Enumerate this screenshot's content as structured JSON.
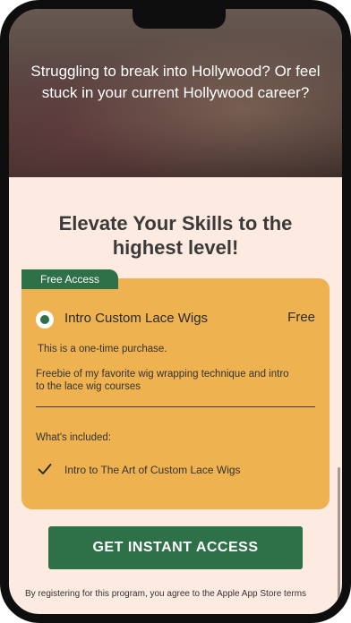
{
  "hero": {
    "text": "Struggling to break into Hollywood? Or feel stuck in your current Hollywood career?"
  },
  "headline": "Elevate Your Skills to the highest level!",
  "plan": {
    "badge": "Free Access",
    "name": "Intro Custom Lace Wigs",
    "price": "Free",
    "purchase_note": "This is a one-time purchase.",
    "description": "Freebie of my favorite wig wrapping technique and intro to the lace wig courses",
    "included_label": "What's included:",
    "included_items": [
      "Intro to The Art of Custom Lace Wigs"
    ],
    "selected": true
  },
  "cta": {
    "label": "GET INSTANT ACCESS"
  },
  "legal": "By registering for this program, you agree to the Apple App Store terms",
  "colors": {
    "accent_green": "#2e7048",
    "card_orange": "#eeb250",
    "background": "#fdebe1"
  }
}
